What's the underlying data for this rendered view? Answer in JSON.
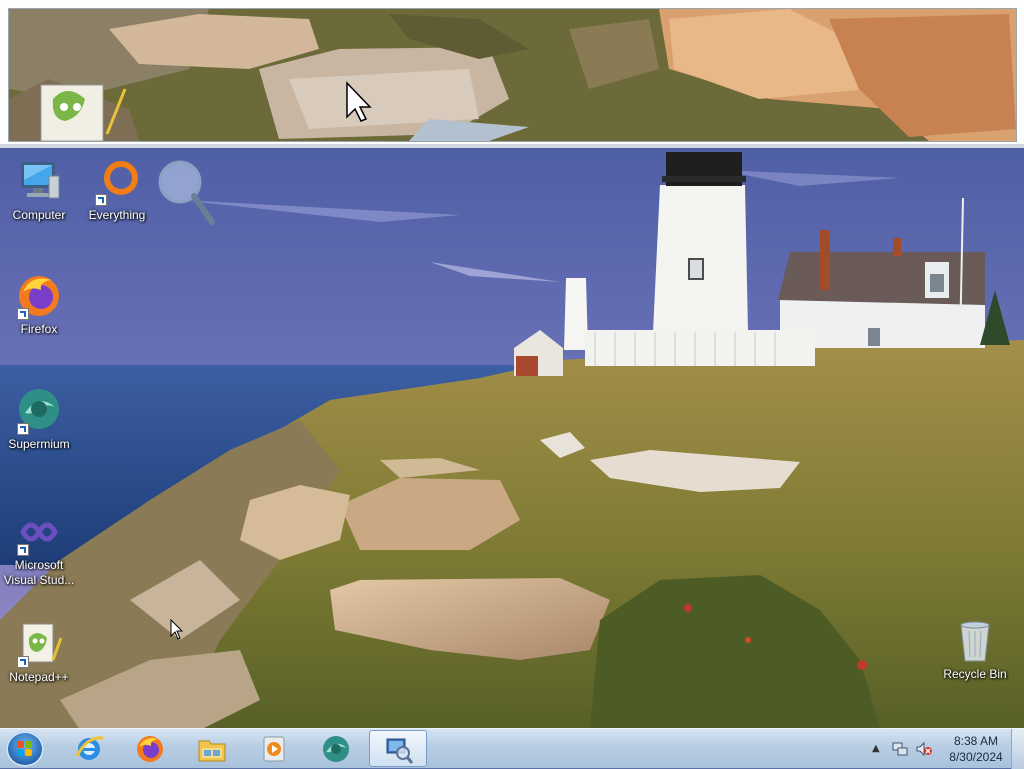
{
  "desktop": {
    "icons": [
      {
        "label": "Computer",
        "icon": "computer-icon"
      },
      {
        "label": "Everything",
        "icon": "everything-search-icon"
      },
      {
        "label": "Firefox",
        "icon": "firefox-icon"
      },
      {
        "label": "Supermium",
        "icon": "supermium-icon"
      },
      {
        "label": "Microsoft Visual Stud...",
        "label_line1": "Microsoft",
        "label_line2": "Visual Stud...",
        "icon": "visual-studio-icon"
      },
      {
        "label": "Notepad++",
        "icon": "notepad-plus-plus-icon"
      },
      {
        "label": "Recycle Bin",
        "icon": "recycle-bin-icon"
      }
    ]
  },
  "magnifier": {
    "tool": "magnifier-lens-icon",
    "view": "zoomed-rocks-view"
  },
  "taskbar": {
    "start": "windows-start-orb",
    "pinned": [
      {
        "icon": "internet-explorer-icon"
      },
      {
        "icon": "firefox-icon"
      },
      {
        "icon": "file-explorer-icon"
      },
      {
        "icon": "media-player-icon"
      },
      {
        "icon": "supermium-icon"
      },
      {
        "icon": "magnifier-icon",
        "active": true
      }
    ],
    "tray": {
      "time": "8:38 AM",
      "date": "8/30/2024",
      "icons": [
        "show-hidden-icons-chevron",
        "network-icon",
        "volume-muted-icon"
      ]
    }
  },
  "colors": {
    "taskbar": "#b7cde3",
    "sky": "#5c6fa8",
    "sea": "#2b4f8f",
    "grass": "#8a7a3a"
  }
}
